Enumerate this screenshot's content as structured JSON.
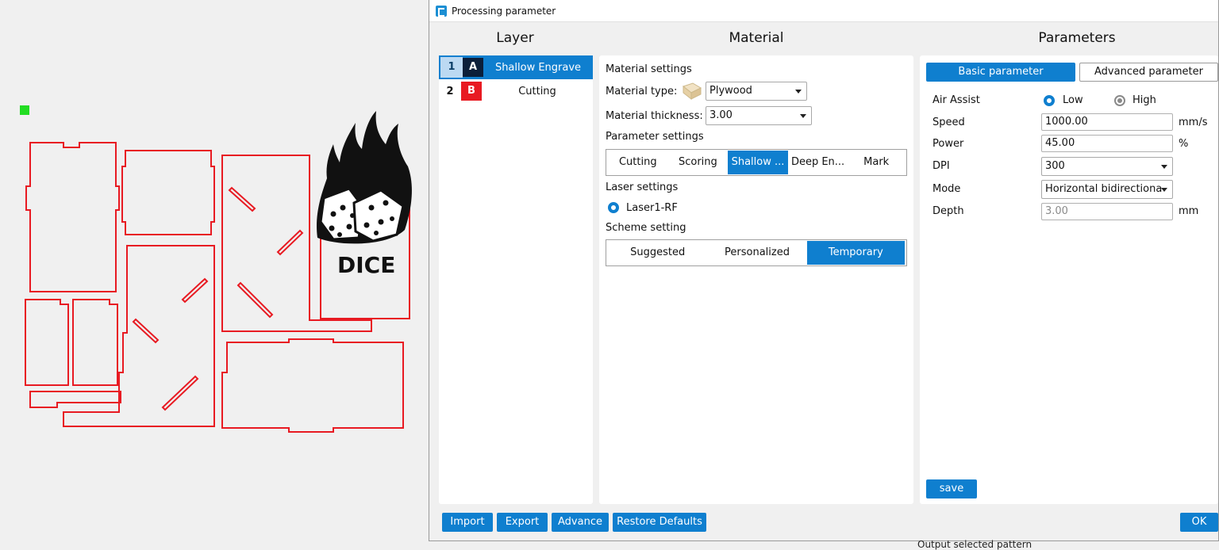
{
  "dialog": {
    "title": "Processing parameter",
    "columns": {
      "layer": "Layer",
      "material": "Material",
      "parameters": "Parameters"
    }
  },
  "layers": [
    {
      "num": "1",
      "letter": "A",
      "name": "Shallow Engrave",
      "color": "#0b1f3a",
      "selected": true
    },
    {
      "num": "2",
      "letter": "B",
      "name": "Cutting",
      "color": "#e81a22",
      "selected": false
    }
  ],
  "material": {
    "settings_heading": "Material settings",
    "type_label": "Material type:",
    "type_value": "Plywood",
    "thickness_label": "Material thickness:",
    "thickness_value": "3.00",
    "param_heading": "Parameter settings",
    "param_tabs": [
      "Cutting",
      "Scoring",
      "Shallow ...",
      "Deep En...",
      "Mark"
    ],
    "laser_heading": "Laser settings",
    "laser_option": "Laser1-RF",
    "scheme_heading": "Scheme setting",
    "scheme_tabs": [
      "Suggested",
      "Personalized",
      "Temporary"
    ]
  },
  "parameters": {
    "tab_basic": "Basic parameter",
    "tab_advanced": "Advanced parameter",
    "air_assist_label": "Air Assist",
    "air_low": "Low",
    "air_high": "High",
    "speed_label": "Speed",
    "speed_value": "1000.00",
    "speed_unit": "mm/s",
    "power_label": "Power",
    "power_value": "45.00",
    "power_unit": "%",
    "dpi_label": "DPI",
    "dpi_value": "300",
    "mode_label": "Mode",
    "mode_value": "Horizontal bidirectiona",
    "depth_label": "Depth",
    "depth_value": "3.00",
    "depth_unit": "mm",
    "save": "save"
  },
  "footer": {
    "import": "Import",
    "export": "Export",
    "advance": "Advance",
    "restore": "Restore Defaults",
    "ok": "OK"
  },
  "canvas": {
    "logo_text": "DICE",
    "cut_color": "#e81a22",
    "marker_color": "#22dd22"
  },
  "status_text": "Output selected pattern"
}
